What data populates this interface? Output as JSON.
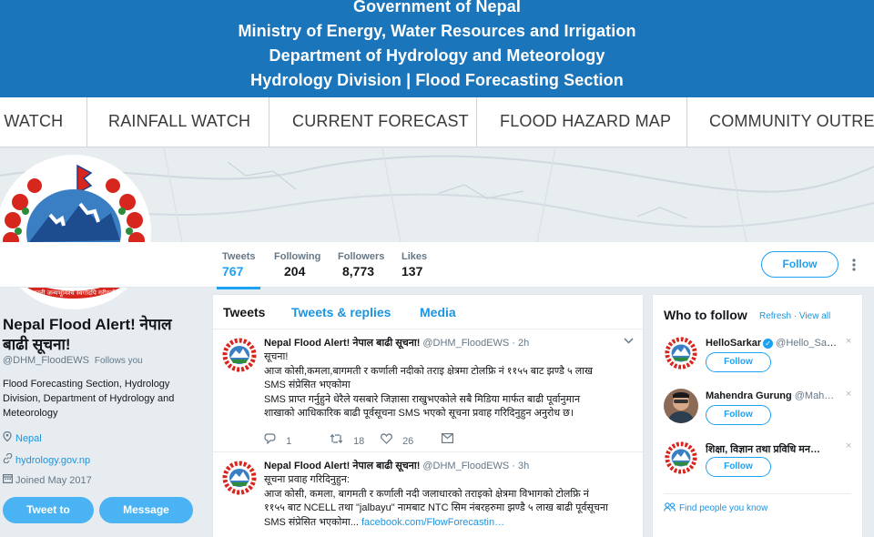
{
  "banner": {
    "line1": "Government of Nepal",
    "line2": "Ministry of Energy, Water Resources and Irrigation",
    "line3": "Department of Hydrology and Meteorology",
    "line4": "Hydrology Division | Flood Forecasting Section"
  },
  "nav": {
    "items": [
      "R WATCH",
      "RAINFALL WATCH",
      "CURRENT FORECAST",
      "FLOOD HAZARD MAP",
      "COMMUNITY OUTREA"
    ]
  },
  "profile_nav": {
    "tweets_label": "Tweets",
    "tweets_count": "767",
    "following_label": "Following",
    "following_count": "204",
    "followers_label": "Followers",
    "followers_count": "8,773",
    "likes_label": "Likes",
    "likes_count": "137",
    "follow_label": "Follow",
    "more_glyph": "⋮"
  },
  "profile": {
    "name": "Nepal Flood Alert! नेपाल बाढी सूचना!",
    "handle": "@DHM_FloodEWS",
    "follows_you": "Follows you",
    "bio": "Flood Forecasting Section, Hydrology Division, Department of Hydrology and Meteorology",
    "location": "Nepal",
    "website": "hydrology.gov.np",
    "joined": "Joined May 2017",
    "tweet_to_label": "Tweet to",
    "message_label": "Message"
  },
  "timeline": {
    "tabs": [
      "Tweets",
      "Tweets & replies",
      "Media"
    ],
    "tweets": [
      {
        "name": "Nepal Flood Alert! नेपाल बाढी सूचना!",
        "handle": "@DHM_FloodEWS · 2h",
        "lines": [
          "सूचना!",
          "आज कोसी,कमला,बागमती र कर्णाली नदीको तराइ क्षेत्रमा टोलफ्रि नं ११५५ बाट झण्डै ५ लाख",
          "SMS संप्रेसित भएकोमा",
          "SMS प्राप्त गर्नुहुने धेरैले यसबारे जिज्ञासा राखुभएकोले सबै मिडिया मार्फत बाढी पूर्वानुमान",
          "शाखाको आधिकारिक बाढी पूर्वसूचना SMS भएको सूचना प्रवाह गरिदिनुहुन अनुरोध छ।"
        ],
        "reply_count": "1",
        "retweet_count": "18",
        "like_count": "26"
      },
      {
        "name": "Nepal Flood Alert! नेपाल बाढी सूचना!",
        "handle": "@DHM_FloodEWS · 3h",
        "lines": [
          "सूचना प्रवाह गरिदिनुहुन:",
          "आज कोसी, कमला, बागमती र कर्णाली नदी जलाधारको तराइको क्षेत्रमा विभागको टोलफ्रि नं",
          "११५५ बाट NCELL तथा \"jalbayu\" नामबाट NTC सिम नंबरहरुमा झण्डै ५ लाख बाढी पूर्वसूचना",
          "SMS संप्रेसित भएकोमा..."
        ],
        "link": "facebook.com/FlowForecastin…"
      }
    ]
  },
  "who_to_follow": {
    "title": "Who to follow",
    "refresh": "Refresh",
    "view_all": "View all",
    "separator": "·",
    "items": [
      {
        "name": "HelloSarkar",
        "handle": "@Hello_Sar…",
        "verified": true,
        "follow": "Follow",
        "dismiss": "×"
      },
      {
        "name": "Mahendra Gurung",
        "handle": "@Mah…",
        "verified": false,
        "follow": "Follow",
        "dismiss": "×"
      },
      {
        "name": "शिक्षा, विज्ञान तथा प्रविधि मन…",
        "handle": "",
        "verified": false,
        "follow": "Follow",
        "dismiss": "×"
      }
    ],
    "find_people": "Find people you know"
  },
  "colors": {
    "banner_bg": "#1b75bb",
    "twitter_blue": "#1da1f2",
    "link_blue": "#1b95e0",
    "button_blue": "#4ab3f4",
    "page_bg": "#e6ecf0"
  },
  "icons": {
    "location": "location-pin-icon",
    "website": "link-icon",
    "joined": "calendar-icon",
    "reply": "reply-icon",
    "retweet": "retweet-icon",
    "like": "heart-icon",
    "dm": "envelope-icon",
    "caret": "chevron-down-icon",
    "people": "people-icon"
  }
}
